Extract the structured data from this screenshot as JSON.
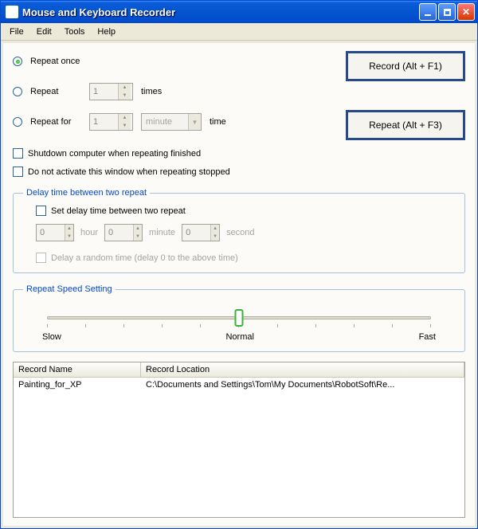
{
  "titlebar": {
    "title": "Mouse and Keyboard Recorder"
  },
  "menu": {
    "file": "File",
    "edit": "Edit",
    "tools": "Tools",
    "help": "Help"
  },
  "options": {
    "repeat_once": "Repeat once",
    "repeat": "Repeat",
    "repeat_times_val": "1",
    "times": "times",
    "repeat_for": "Repeat for",
    "repeat_for_val": "1",
    "unit": "minute",
    "time": "time",
    "shutdown": "Shutdown computer when repeating finished",
    "no_activate": "Do not activate this window when repeating stopped"
  },
  "buttons": {
    "record": "Record (Alt + F1)",
    "repeat": "Repeat (Alt + F3)"
  },
  "delay": {
    "legend": "Delay time between two repeat",
    "set_label": "Set delay time between two repeat",
    "hour_val": "0",
    "hour": "hour",
    "minute_val": "0",
    "minute": "minute",
    "second_val": "0",
    "second": "second",
    "random": "Delay a random time (delay 0 to the above time)"
  },
  "speed": {
    "legend": "Repeat Speed Setting",
    "slow": "Slow",
    "normal": "Normal",
    "fast": "Fast"
  },
  "table": {
    "col1": "Record Name",
    "col2": "Record Location",
    "rows": [
      {
        "name": "Painting_for_XP",
        "location": "C:\\Documents and Settings\\Tom\\My Documents\\RobotSoft\\Re..."
      }
    ]
  }
}
